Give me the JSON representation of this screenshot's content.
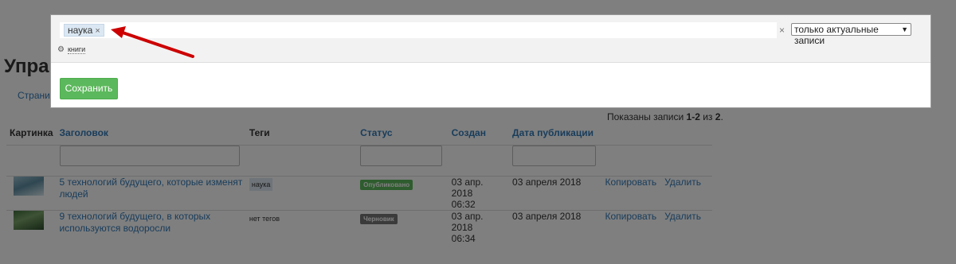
{
  "page": {
    "title": "Упра",
    "tab": "Страниц",
    "shown_prefix": "Показаны записи ",
    "shown_range": "1-2",
    "shown_mid": " из ",
    "shown_total": "2",
    "shown_suffix": "."
  },
  "table": {
    "headers": [
      "Картинка",
      "Заголовок",
      "Теги",
      "Статус",
      "Создан",
      "Дата публикации"
    ],
    "rows": [
      {
        "title_line1": "5 технологий будущего, которые изменят",
        "title_line2": "людей",
        "tag": "наука",
        "status": "Опубликовано",
        "created_date": "03 апр. 2018",
        "created_time": "06:32",
        "published": "03 апреля 2018",
        "copy": "Копировать",
        "delete": "Удалить"
      },
      {
        "title_line1": "9 технологий будущего, в которых",
        "title_line2": "используются водоросли",
        "tag": "нет тегов",
        "status": "Черновик",
        "created_date": "03 апр. 2018",
        "created_time": "06:34",
        "published": "03 апреля 2018",
        "copy": "Копировать",
        "delete": "Удалить"
      }
    ]
  },
  "modal": {
    "chip_label": "наука",
    "chip_remove": "×",
    "clear_all": "×",
    "filter_select": "только актуальные записи",
    "filter_arrow": "▼",
    "category_icon": "gear-icon",
    "category_label": "книги",
    "save_label": "Сохранить"
  },
  "colors": {
    "link": "#337ab7",
    "save": "#5cb85c",
    "published_badge": "#5cb85c",
    "draft_badge": "#777777",
    "arrow": "#cc0000"
  }
}
